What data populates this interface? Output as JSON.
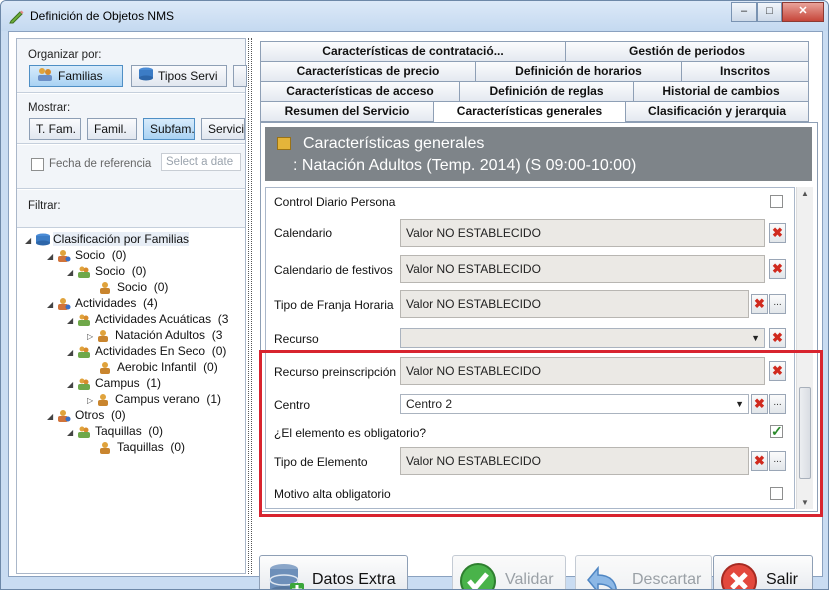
{
  "window": {
    "title": "Definición de Objetos NMS",
    "minimize": "–",
    "maximize": "□",
    "close": "✕"
  },
  "left": {
    "organizar_label": "Organizar por:",
    "organizar_buttons": [
      "Familias",
      "Tipos Servi"
    ],
    "mostrar_label": "Mostrar:",
    "mostrar_buttons": [
      "T. Fam.",
      "Famil.",
      "Subfam.",
      "Servici"
    ],
    "fecha_label": "Fecha de referencia",
    "date_placeholder": "Select a date",
    "filtrar_label": "Filtrar:",
    "tree": [
      {
        "label": "Clasificación por Familias",
        "count": ""
      },
      {
        "label": "Socio",
        "count": "(0)"
      },
      {
        "label": "Socio",
        "count": "(0)"
      },
      {
        "label": "Socio",
        "count": "(0)"
      },
      {
        "label": "Actividades",
        "count": "(4)"
      },
      {
        "label": "Actividades Acuáticas",
        "count": "(3"
      },
      {
        "label": "Natación Adultos",
        "count": "(3"
      },
      {
        "label": "Actividades En Seco",
        "count": "(0)"
      },
      {
        "label": "Aerobic Infantil",
        "count": "(0)"
      },
      {
        "label": "Campus",
        "count": "(1)"
      },
      {
        "label": "Campus verano",
        "count": "(1)"
      },
      {
        "label": "Otros",
        "count": "(0)"
      },
      {
        "label": "Taquillas",
        "count": "(0)"
      },
      {
        "label": "Taquillas",
        "count": "(0)"
      }
    ]
  },
  "tabs": {
    "row1": [
      "Características de contratació...",
      "Gestión de periodos"
    ],
    "row2": [
      "Características de precio",
      "Definición de horarios",
      "Inscritos"
    ],
    "row3": [
      "Características de acceso",
      "Definición de reglas",
      "Historial de cambios"
    ],
    "row4": [
      "Resumen del Servicio",
      "Características generales",
      "Clasificación y jerarquia"
    ]
  },
  "header": {
    "line1": "Características generales",
    "line2": ": Natación Adultos (Temp. 2014) (S 09:00-10:00)"
  },
  "props": {
    "control_diario": "Control Diario Persona",
    "calendario": "Calendario",
    "calendario_val": "Valor NO ESTABLECIDO",
    "festivos": "Calendario de festivos",
    "festivos_val": "Valor NO ESTABLECIDO",
    "franja": "Tipo de Franja Horaria",
    "franja_val": "Valor NO ESTABLECIDO",
    "recurso": "Recurso",
    "recurso_val": "",
    "preinscripcion": "Recurso preinscripción",
    "preinscripcion_val": "Valor NO ESTABLECIDO",
    "centro": "Centro",
    "centro_val": "Centro 2",
    "obligatorio": "¿El elemento es obligatorio?",
    "tipo_elemento": "Tipo de Elemento",
    "tipo_elemento_val": "Valor NO ESTABLECIDO",
    "motivo_alta": "Motivo alta obligatorio"
  },
  "buttons": {
    "datos_extra": "Datos Extra",
    "validar": "Validar",
    "descartar": "Descartar",
    "salir": "Salir"
  },
  "colors": {
    "highlight": "#d8242f",
    "header_bg": "#7e8489",
    "clear_red": "#d02a1e"
  }
}
